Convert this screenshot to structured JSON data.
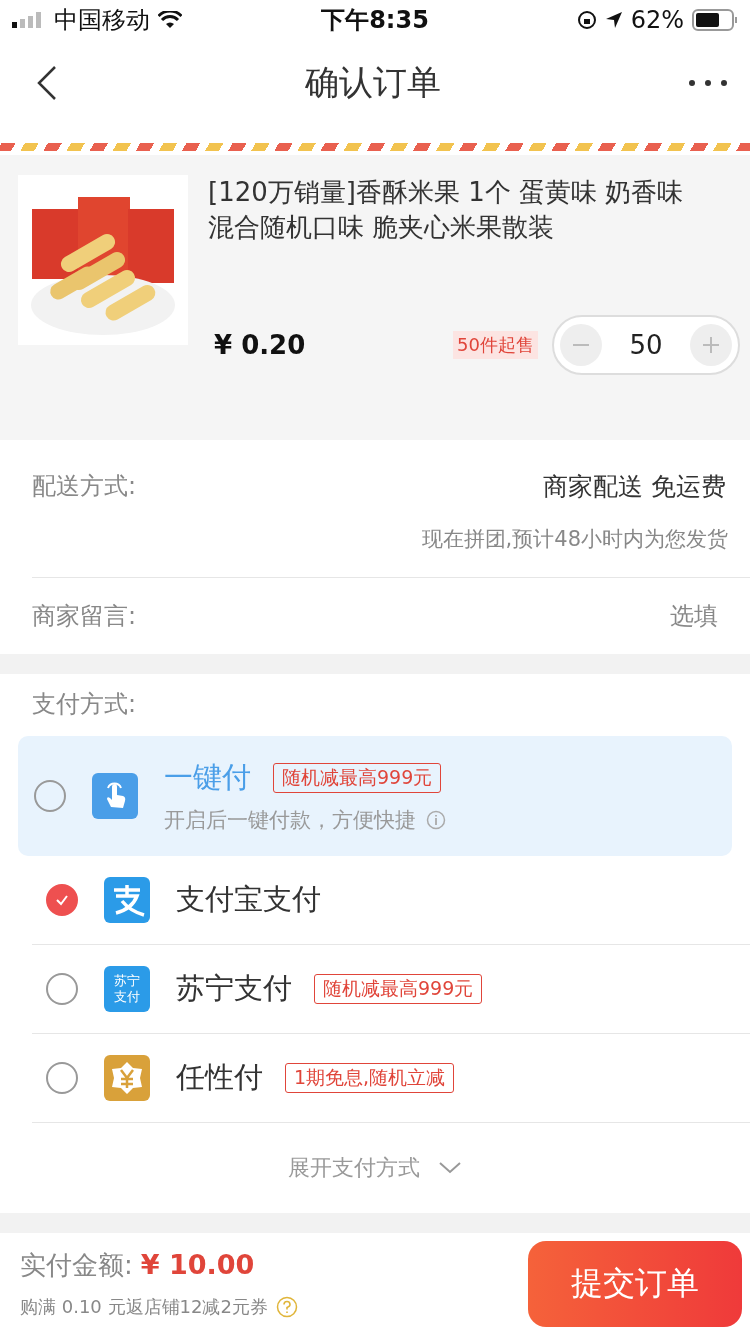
{
  "status_bar": {
    "carrier": "中国移动",
    "time": "下午8:35",
    "battery": "62%"
  },
  "nav": {
    "title": "确认订单"
  },
  "product": {
    "title": "[120万销量]香酥米果 1个 蛋黄味 奶香味混合随机口味 脆夹心米果散装",
    "price": "¥ 0.20",
    "min_order": "50件起售",
    "quantity": "50"
  },
  "delivery": {
    "label": "配送方式:",
    "value": "商家配送 免运费",
    "note": "现在拼团,预计48小时内为您发货"
  },
  "message": {
    "label": "商家留言:",
    "placeholder": "选填"
  },
  "payment": {
    "label": "支付方式:",
    "methods": [
      {
        "kind": "tap",
        "name": "一键付",
        "tag": "随机减最高999元",
        "subtitle": "开启后一键付款，方便快捷",
        "highlighted": true,
        "selected": false
      },
      {
        "kind": "alipay",
        "name": "支付宝支付",
        "highlighted": false,
        "selected": true
      },
      {
        "kind": "suning",
        "name": "苏宁支付",
        "icon_lines": [
          "苏宁",
          "支付"
        ],
        "tag": "随机减最高999元",
        "highlighted": false,
        "selected": false
      },
      {
        "kind": "renxing",
        "name": "任性付",
        "tag": "1期免息,随机立减",
        "highlighted": false,
        "selected": false
      }
    ],
    "expand": "展开支付方式"
  },
  "footer": {
    "label": "实付金额:",
    "amount": "¥ 10.00",
    "promo": "购满 0.10 元返店铺12减2元券",
    "submit": "提交订单"
  }
}
